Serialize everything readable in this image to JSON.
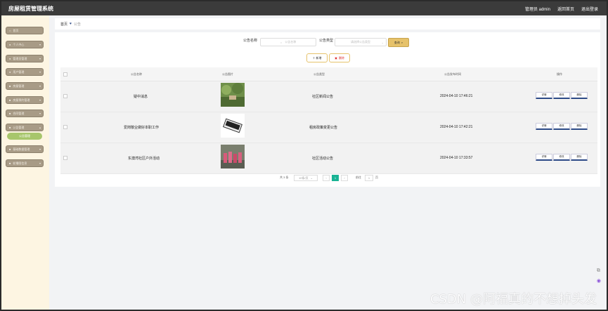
{
  "app": {
    "title": "房屋租赁管理系统"
  },
  "topbar": {
    "user": "管理员 admin",
    "home_link": "返回首页",
    "logout": "退出登录"
  },
  "sidebar": {
    "items": [
      {
        "label": "首页",
        "expandable": false
      },
      {
        "label": "个人中心",
        "expandable": true
      },
      {
        "label": "管理员管理",
        "expandable": true
      },
      {
        "label": "用户管理",
        "expandable": true
      },
      {
        "label": "房屋管理",
        "expandable": true
      },
      {
        "label": "房屋预约管理",
        "expandable": true
      },
      {
        "label": "合同管理",
        "expandable": true
      },
      {
        "label": "公告管理",
        "expandable": true,
        "active": true
      },
      {
        "label": "基础数据管理",
        "expandable": true
      },
      {
        "label": "轮播图信息",
        "expandable": true
      }
    ],
    "submenu": {
      "label": "公告管理"
    }
  },
  "breadcrumb": {
    "home": "首页",
    "current": "公告"
  },
  "search": {
    "name_label": "公告名称",
    "name_placeholder": "公告名称",
    "type_label": "公告类型",
    "type_placeholder": "请选择公告类型",
    "query_button": "查询"
  },
  "actions": {
    "add": "＋ 新增",
    "delete": "删除"
  },
  "table": {
    "headers": [
      "公告名称",
      "公告图片",
      "公告类型",
      "公告发布时间",
      "操作"
    ],
    "rows": [
      {
        "name": "疑中消息",
        "type": "社区新闻公告",
        "time": "2024-04-10 17:46:21"
      },
      {
        "name": "爱岗敬业做好本职工作",
        "type": "租房政策变更公告",
        "time": "2024-04-10 17:42:21"
      },
      {
        "name": "东澳湾社区户外活动",
        "type": "社区活动公告",
        "time": "2024-04-10 17:33:57"
      }
    ],
    "op_buttons": {
      "detail": "详情",
      "edit": "修改",
      "delete": "删除"
    }
  },
  "pagination": {
    "total": "共 3 条",
    "page_size": "10条/页",
    "current_page": "1",
    "goto_label": "前往",
    "goto_value": "1",
    "page_suffix": "页"
  },
  "watermark": "CSDN @阿福真的不想掉头发",
  "colors": {
    "topbar": "#3b3b3b",
    "sidebar": "#fdf5e2",
    "menu": "#a89b86",
    "submenu": "#a7c66b",
    "accent": "#e6c26a",
    "pager_current": "#19b394"
  }
}
